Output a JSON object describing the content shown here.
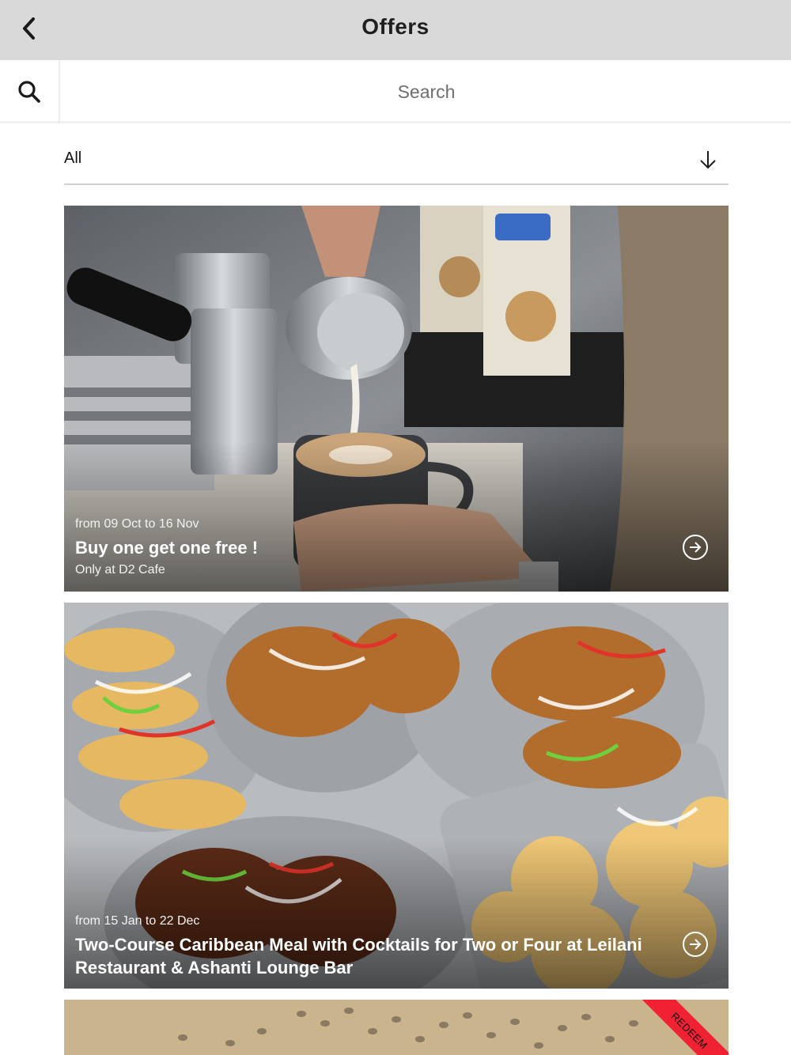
{
  "header": {
    "title": "Offers",
    "back_icon": "chevron-left-icon"
  },
  "search": {
    "placeholder": "Search",
    "icon": "search-icon"
  },
  "filter": {
    "selected": "All",
    "icon": "arrow-down-icon"
  },
  "offers": [
    {
      "dates": "from 09 Oct to 16 Nov",
      "title": "Buy one get one free !",
      "subtitle": "Only at D2 Cafe",
      "image": "latte-art-photo",
      "action_icon": "arrow-right-circle-icon"
    },
    {
      "dates": "from 15 Jan to 22 Dec",
      "title": "Two-Course Caribbean Meal with Cocktails for Two or Four at Leilani Restaurant & Ashanti Lounge Bar",
      "subtitle": "",
      "image": "caribbean-food-platter-photo",
      "action_icon": "arrow-right-circle-icon"
    },
    {
      "image": "coffee-beans-burlap-photo",
      "badge": "REDEEM",
      "badge_color": "#ef2133"
    }
  ]
}
